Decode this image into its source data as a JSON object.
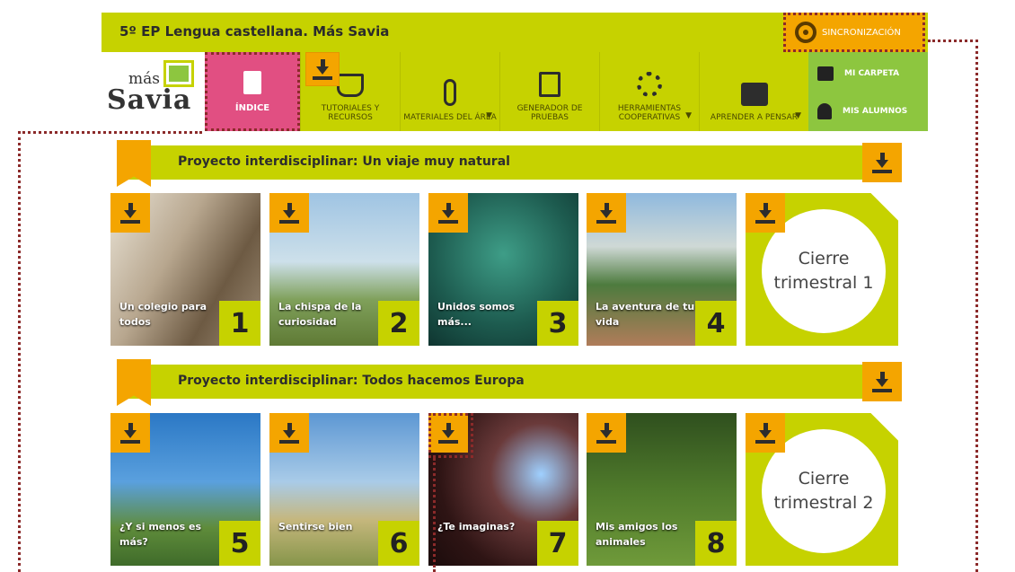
{
  "header": {
    "title": "5º EP Lengua castellana. Más Savia",
    "sync_label": "SINCRONIZACIÓN"
  },
  "logo": {
    "line1": "más",
    "line2": "Savia"
  },
  "nav": {
    "indice": "ÍNDICE",
    "items": [
      {
        "label": "TUTORIALES Y RECURSOS"
      },
      {
        "label": "MATERIALES DEL ÁREA"
      },
      {
        "label": "GENERADOR DE PRUEBAS"
      },
      {
        "label": "HERRAMIENTAS COOPERATIVAS"
      },
      {
        "label": "APRENDER A PENSAR"
      }
    ],
    "side": [
      {
        "label": "MI CARPETA"
      },
      {
        "label": "MIS ALUMNOS"
      }
    ]
  },
  "sections": [
    {
      "title": "Proyecto interdisciplinar: Un viaje muy natural",
      "cards": [
        {
          "label": "Un colegio para todos",
          "num": "1"
        },
        {
          "label": "La chispa de la curiosidad",
          "num": "2"
        },
        {
          "label": "Unidos somos más...",
          "num": "3"
        },
        {
          "label": "La aventura de tu vida",
          "num": "4"
        }
      ],
      "cierre": "Cierre trimestral 1"
    },
    {
      "title": "Proyecto interdisciplinar: Todos hacemos Europa",
      "cards": [
        {
          "label": "¿Y si menos es más?",
          "num": "5"
        },
        {
          "label": "Sentirse bien",
          "num": "6"
        },
        {
          "label": "¿Te imaginas?",
          "num": "7"
        },
        {
          "label": "Mis amigos los animales",
          "num": "8"
        }
      ],
      "cierre": "Cierre trimestral 2"
    }
  ],
  "colors": {
    "lime": "#c6d200",
    "orange": "#f4a500",
    "pink": "#e14f82",
    "green": "#8dc63f",
    "annotation": "#8b2a2a"
  }
}
